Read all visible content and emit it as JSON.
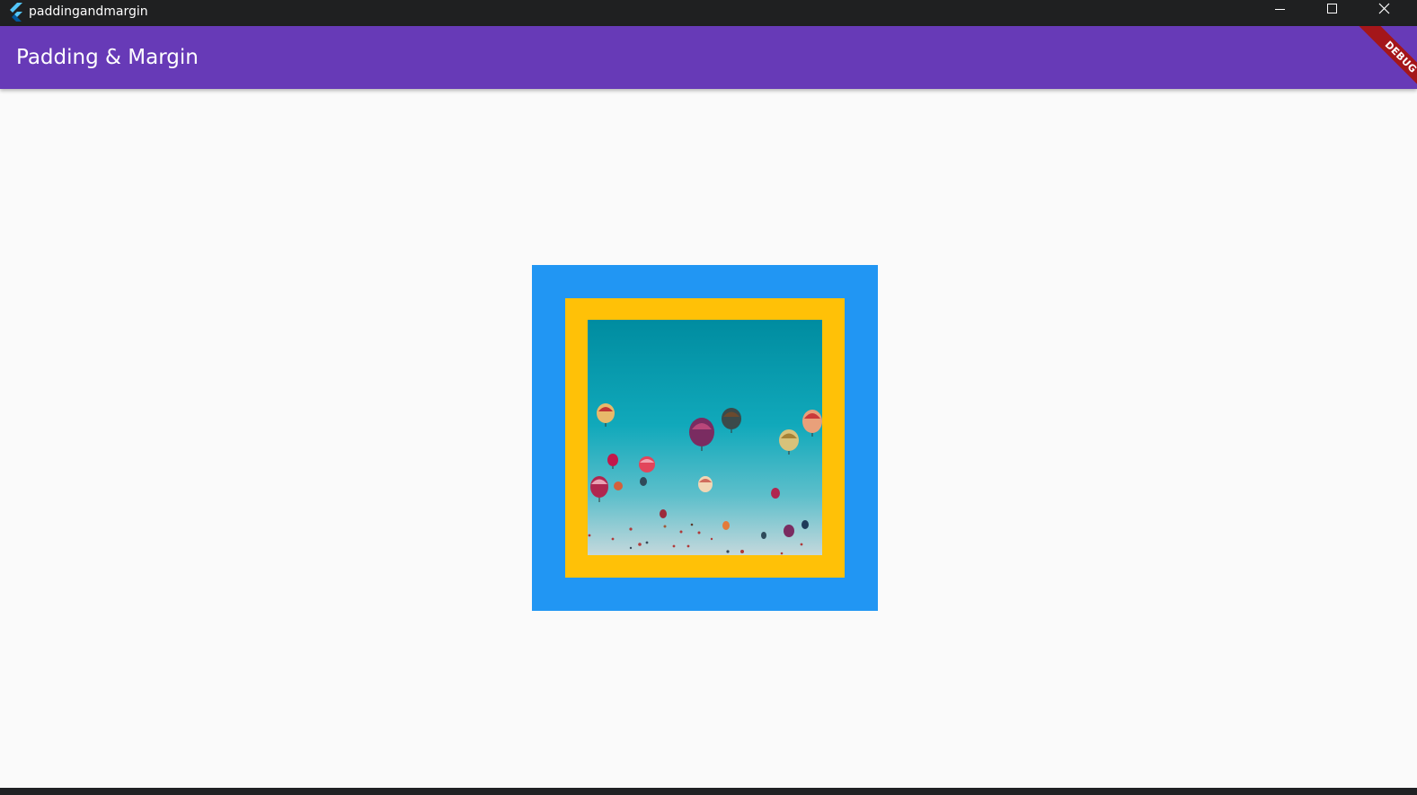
{
  "window": {
    "title": "paddingandmargin",
    "app_icon": "flutter-logo-icon",
    "controls": [
      "minimize-icon",
      "maximize-icon",
      "close-icon"
    ]
  },
  "appbar": {
    "title": "Padding & Margin",
    "color": "#673ab7"
  },
  "debug_banner": {
    "label": "DEBUG",
    "color": "#a4161a"
  },
  "body": {
    "background": "#fafafa",
    "outer_container_color": "#2196f3",
    "inner_container_color": "#ffc107",
    "image": "hot-air-balloons-image"
  }
}
